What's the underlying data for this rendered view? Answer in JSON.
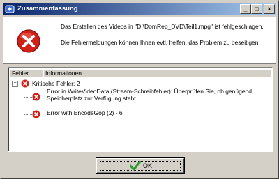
{
  "window": {
    "title": "Zusammenfassung",
    "buttons": {
      "minimize": "_",
      "maximize": "□",
      "close": "×"
    }
  },
  "message": {
    "line1": "Das Erstellen des Videos in \"D:\\DomRep_DVD\\Teil1.mpg\" ist fehlgeschlagen.",
    "line2": "Die Fehlermeldungen können Ihnen evtl. helfen, das Problem zu beseitigen."
  },
  "tree": {
    "columns": [
      "Fehler",
      "Informationen"
    ],
    "root": {
      "expander": "−",
      "label": "Kritische Fehler: 2"
    },
    "items": [
      {
        "text": "Error in WriteVideoData (Stream-Schreibfehler): Überprüfen Sie, ob genügend Speicherplatz zur Verfügung steht"
      },
      {
        "text": "Error with EncodeGop (2) - 6"
      }
    ]
  },
  "ok_button": {
    "label": "OK"
  },
  "colors": {
    "titlebar_start": "#0a246a",
    "titlebar_end": "#a6caf0",
    "error_red": "#d0201a",
    "check_green": "#2e9a2e"
  }
}
